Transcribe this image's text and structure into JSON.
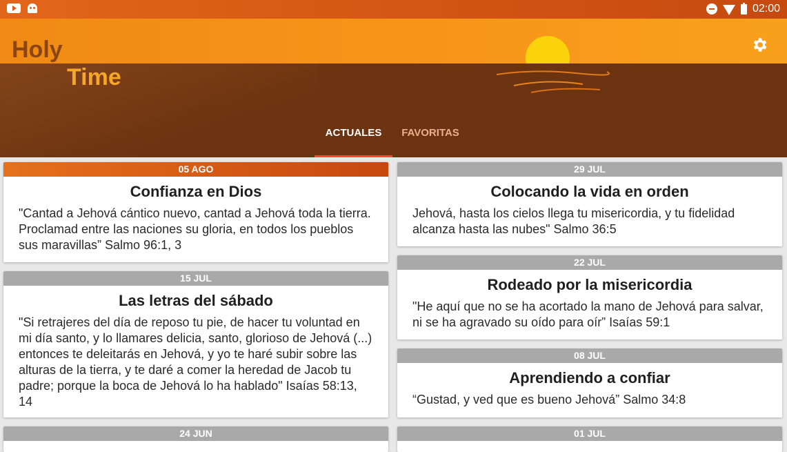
{
  "status_bar": {
    "time": "02:00"
  },
  "app": {
    "title_line1": "Holy",
    "title_line2": "Time"
  },
  "tabs": [
    {
      "label": "ACTUALES",
      "active": true
    },
    {
      "label": "FAVORITAS",
      "active": false
    }
  ],
  "colors": {
    "accent": "#f7951a",
    "brown": "#6b3310",
    "indicator": "#f24a37",
    "sun": "#fbd30c"
  },
  "cards": [
    {
      "date": "05 AGO",
      "title": "Confianza en Dios",
      "text": "\"Cantad a Jehová cántico nuevo, cantad a Jehová toda la tierra. Proclamad entre las naciones su gloria, en todos los pueblos sus maravillas” Salmo 96:1, 3",
      "current": true
    },
    {
      "date": "29 JUL",
      "title": "Colocando la vida en orden",
      "text": "Jehová, hasta los cielos llega tu misericordia, y tu fidelidad alcanza hasta las nubes\" Salmo 36:5",
      "current": false
    },
    {
      "date": "15 JUL",
      "title": "Las letras del sábado",
      "text": "\"Si retrajeres del día de reposo tu pie, de hacer tu voluntad en mi día santo, y lo llamares delicia, santo, glorioso de Jehová (...) entonces te deleitarás en Jehová, y yo te haré subir sobre las alturas de la tierra, y te daré a comer la heredad de Jacob tu padre; porque la boca de Jehová lo ha hablado\" Isaías 58:13, 14",
      "current": false
    },
    {
      "date": "22 JUL",
      "title": "Rodeado por la misericordia",
      "text": "\"He aquí que no se ha acortado la mano de Jehová para salvar, ni se ha agravado su oído para oír” Isaías 59:1",
      "current": false
    },
    {
      "date": "08 JUL",
      "title": "Aprendiendo a confiar",
      "text": "“Gustad, y ved que es bueno Jehová” Salmo 34:8",
      "current": false
    },
    {
      "date": "24 JUN",
      "title": "",
      "text": "",
      "current": false
    },
    {
      "date": "01 JUL",
      "title": "",
      "text": "",
      "current": false
    }
  ]
}
